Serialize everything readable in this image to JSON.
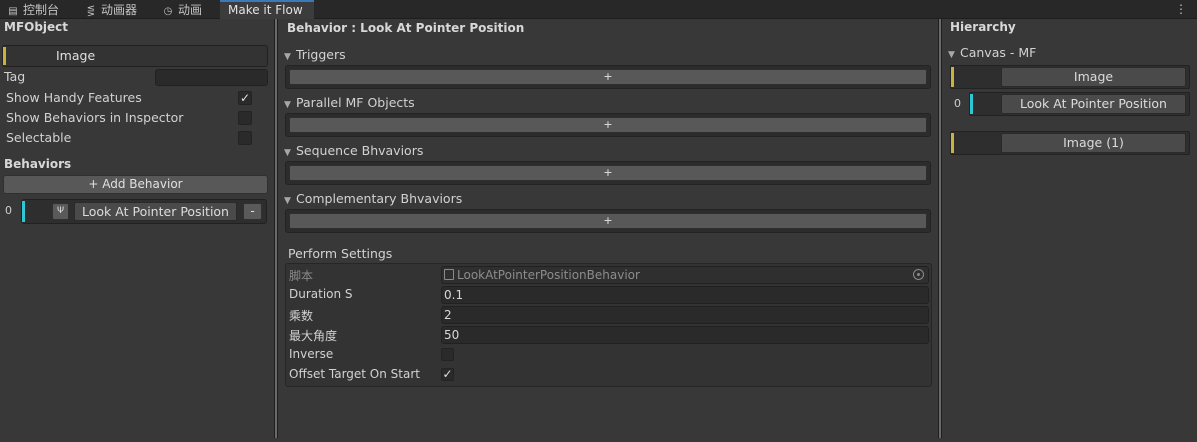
{
  "tabs": [
    {
      "label": "控制台",
      "icon": "console-icon"
    },
    {
      "label": "动画器",
      "icon": "animator-icon"
    },
    {
      "label": "动画",
      "icon": "animation-icon"
    },
    {
      "label": "Make it Flow"
    }
  ],
  "mfobject": {
    "title": "MFObject",
    "object_name": "Image",
    "tag_label": "Tag",
    "tag_value": "",
    "options": [
      {
        "label": "Show Handy Features",
        "checked": true
      },
      {
        "label": "Show Behaviors in Inspector",
        "checked": false
      },
      {
        "label": "Selectable",
        "checked": false
      }
    ],
    "behaviors_title": "Behaviors",
    "add_behavior_label": "+ Add Behavior",
    "behavior_items": [
      {
        "index": "0",
        "name": "Look At Pointer Position",
        "remove_label": "-"
      }
    ]
  },
  "behavior": {
    "title": "Behavior : Look At Pointer Position",
    "sections": [
      {
        "label": "Triggers",
        "add_label": "+"
      },
      {
        "label": "Parallel MF Objects",
        "add_label": "+"
      },
      {
        "label": "Sequence Bhvaviors",
        "add_label": "+"
      },
      {
        "label": "Complementary Bhvaviors",
        "add_label": "+"
      }
    ],
    "perform_settings_title": "Perform Settings",
    "settings": [
      {
        "label": "脚本",
        "value": "LookAtPointerPositionBehavior"
      },
      {
        "label": "Duration S",
        "value": "0.1"
      },
      {
        "label": "乘数",
        "value": "2"
      },
      {
        "label": "最大角度",
        "value": "50"
      },
      {
        "label": "Inverse",
        "checked": false
      },
      {
        "label": "Offset Target On Start",
        "checked": true
      }
    ]
  },
  "hierarchy": {
    "title": "Hierarchy",
    "root_label": "Canvas - MF",
    "items": [
      {
        "name": "Image",
        "index": "",
        "color": "#c8b43c"
      },
      {
        "name": "Look At Pointer Position",
        "index": "0",
        "color": "#2fc6d6"
      },
      {
        "name": "Image (1)",
        "index": "",
        "color": "#c8b43c"
      }
    ]
  },
  "colors": {
    "object_accent": "#c8b43c",
    "behavior_accent": "#2fc6d6",
    "active_tab_accent": "#3a79bb"
  }
}
